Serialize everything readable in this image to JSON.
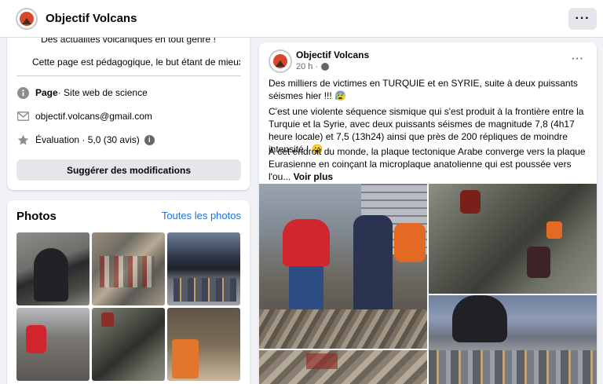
{
  "header": {
    "page_name": "Objectif Volcans",
    "more_label": "···"
  },
  "intro": {
    "tagline": "Des actualités volcaniques en tout genre !",
    "description": "Cette page est pédagogique, le but étant de mieux co",
    "category_bold": "Page",
    "category_rest": " · Site web de science",
    "email": "objectif.volcans@gmail.com",
    "rating": "Évaluation · 5,0 (30 avis)",
    "info_badge": "i",
    "suggest_button": "Suggérer des modifications"
  },
  "photos": {
    "title": "Photos",
    "all_photos_link": "Toutes les photos",
    "count": 6
  },
  "post": {
    "author": "Objectif Volcans",
    "time": "20 h ·",
    "more_label": "···",
    "paragraph1": "Des milliers de victimes en TURQUIE et en SYRIE, suite à deux puissants séismes hier !!! 😰",
    "paragraph2": "C'est une violente séquence sismique qui s'est produit à la frontière entre la Turquie et la Syrie, avec deux puissants séismes de magnitude 7,8 (4h17 heure locale) et 7,5 (13h24) ainsi que près de 200 répliques de moindre intensité ! 😮",
    "paragraph3": "À cet endroit du monde, la plaque tectonique Arabe converge vers la plaque Eurasienne en coinçant la microplaque anatolienne qui est poussée vers l'ou... ",
    "see_more": "Voir plus"
  },
  "colors": {
    "link_blue": "#1b74e4",
    "button_grey": "#e4e6eb",
    "background": "#f0f2f5"
  },
  "icons": [
    "info-icon",
    "email-icon",
    "star-icon",
    "globe-icon",
    "more-icon"
  ]
}
